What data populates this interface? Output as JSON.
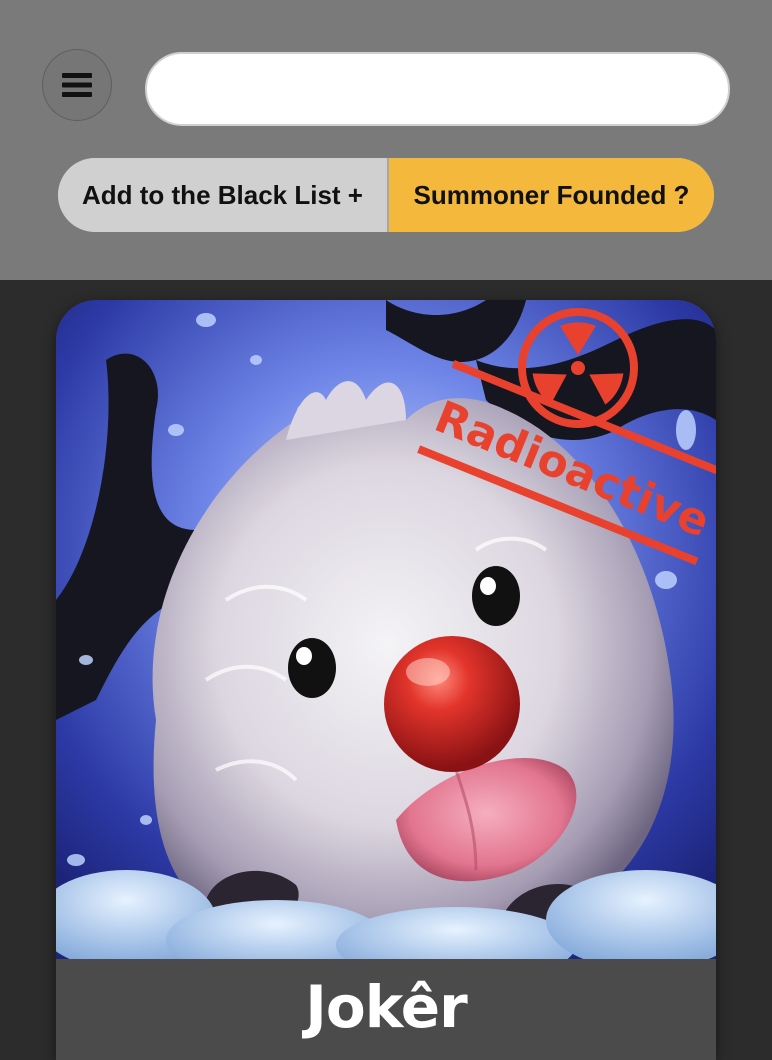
{
  "header": {
    "menu_icon": "hamburger-menu-icon",
    "search": {
      "value": "",
      "placeholder": ""
    },
    "actions": {
      "blacklist_label": "Add to the Black List +",
      "found_label": "Summoner Founded ?"
    }
  },
  "card": {
    "avatar_icon": "poro-clown-avatar",
    "badge": {
      "icon": "radiation-icon",
      "text": "Radioactive",
      "color": "#e8412e"
    },
    "summoner_name": "Jokêr"
  },
  "colors": {
    "header_bg": "#7a7a7a",
    "page_bg": "#2c2c2c",
    "accent": "#f4b93c",
    "stamp_red": "#e8412e"
  }
}
